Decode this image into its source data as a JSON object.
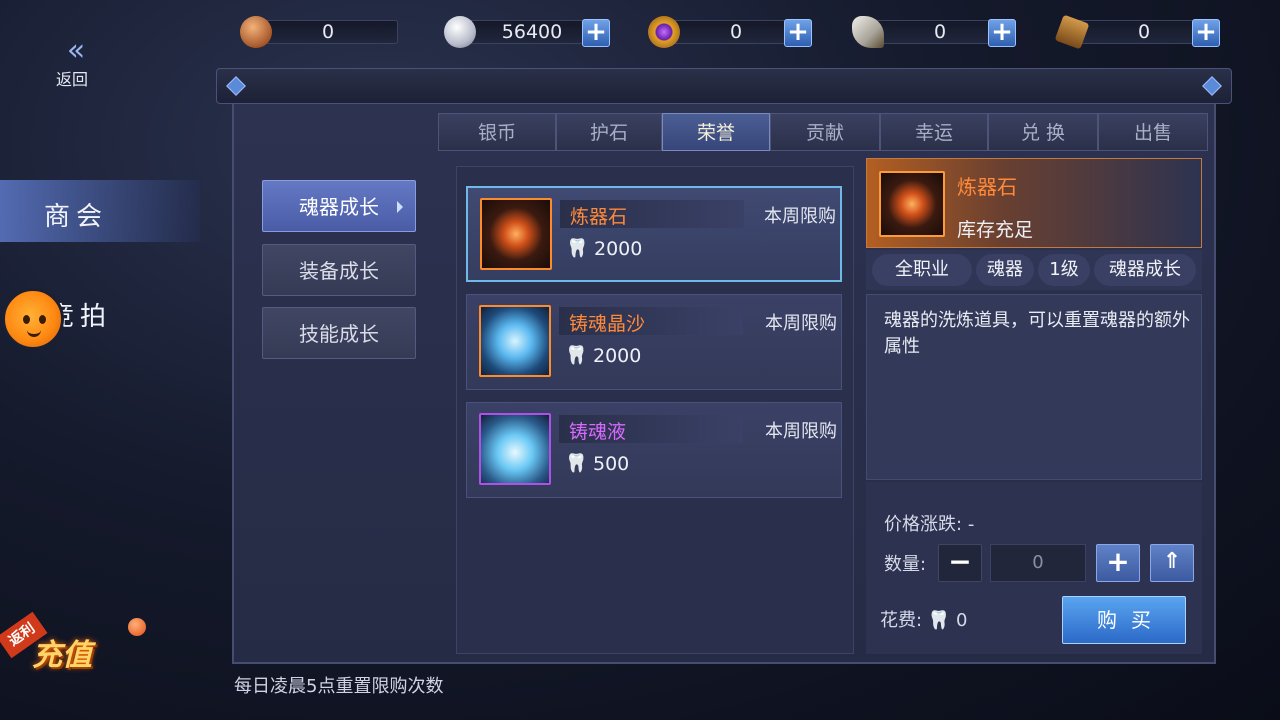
{
  "currencies": [
    {
      "name": "copper-coin-icon",
      "value": "0",
      "has_plus": false
    },
    {
      "name": "silver-coin-icon",
      "value": "56400",
      "has_plus": true
    },
    {
      "name": "purple-gem-icon",
      "value": "0",
      "has_plus": true
    },
    {
      "name": "honor-horn-icon",
      "value": "0",
      "has_plus": true
    },
    {
      "name": "contribution-token-icon",
      "value": "0",
      "has_plus": true
    }
  ],
  "back": {
    "label": "返回"
  },
  "side_nav": {
    "items": [
      {
        "label": "商会",
        "active": true
      },
      {
        "label": "竞拍",
        "active": false
      }
    ]
  },
  "recharge": {
    "badge": "返利",
    "label": "充值"
  },
  "tabs": [
    {
      "label": "银币",
      "active": false
    },
    {
      "label": "护石",
      "active": false
    },
    {
      "label": "荣誉",
      "active": true
    },
    {
      "label": "贡献",
      "active": false
    },
    {
      "label": "幸运",
      "active": false
    },
    {
      "label": "兑 换",
      "active": false
    },
    {
      "label": "出售",
      "active": false
    }
  ],
  "categories": [
    {
      "label": "魂器成长",
      "active": true
    },
    {
      "label": "装备成长",
      "active": false
    },
    {
      "label": "技能成长",
      "active": false
    }
  ],
  "items": [
    {
      "name": "炼器石",
      "limit": "本周限购",
      "price": "2000",
      "name_color": "#ff8a3a",
      "border_color": "#ff8a2a",
      "active": true
    },
    {
      "name": "铸魂晶沙",
      "limit": "本周限购",
      "price": "2000",
      "name_color": "#ff8a3a",
      "border_color": "#ff8a2a",
      "active": false
    },
    {
      "name": "铸魂液",
      "limit": "本周限购",
      "price": "500",
      "name_color": "#d86aff",
      "border_color": "#b050e8",
      "active": false
    }
  ],
  "detail": {
    "name": "炼器石",
    "stock": "库存充足",
    "tags": [
      "全职业",
      "魂器",
      "1级",
      "魂器成长"
    ],
    "description": "魂器的洗炼道具，可以重置魂器的额外属性",
    "price_change_label": "价格涨跌:",
    "price_change_value": "-",
    "quantity_label": "数量:",
    "quantity_value": "0",
    "cost_label": "花费:",
    "cost_value": "0",
    "buy_label": "购买"
  },
  "footer_note": "每日凌晨5点重置限购次数",
  "colors": {
    "accent": "#4a5ca6",
    "orange_item": "#ff8a3a",
    "purple_item": "#d86aff",
    "buy_button": "#2c6ac8"
  }
}
